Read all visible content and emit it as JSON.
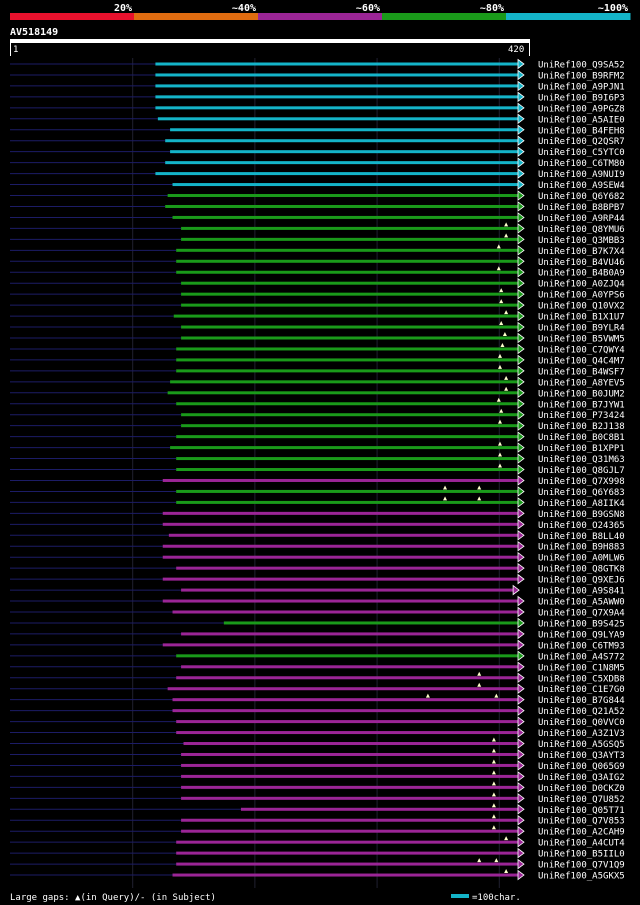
{
  "chart_data": {
    "type": "alignment-overview",
    "query_id": "AV518149",
    "query_start_label": "1",
    "query_end_label": "420",
    "query_length": 420,
    "identity_legend": [
      {
        "label": "20%",
        "color": "#e8112d"
      },
      {
        "label": "~40%",
        "color": "#e06c10"
      },
      {
        "label": "~60%",
        "color": "#9b2596"
      },
      {
        "label": "~80%",
        "color": "#1a9a1a"
      },
      {
        "label": "~100%",
        "color": "#14b4c8"
      }
    ],
    "footer_legend": "Large gaps: ▲(in Query)/- (in Subject)",
    "scale_legend": "=100char.",
    "hits": [
      {
        "name": "UniRef100_Q9SA52",
        "start": 120,
        "end": 420,
        "cls": 4,
        "gaps": []
      },
      {
        "name": "UniRef100_B9RFM2",
        "start": 120,
        "end": 420,
        "cls": 4,
        "gaps": []
      },
      {
        "name": "UniRef100_A9PJN1",
        "start": 120,
        "end": 420,
        "cls": 4,
        "gaps": []
      },
      {
        "name": "UniRef100_B9I6P3",
        "start": 120,
        "end": 420,
        "cls": 4,
        "gaps": []
      },
      {
        "name": "UniRef100_A9PGZ8",
        "start": 120,
        "end": 420,
        "cls": 4,
        "gaps": []
      },
      {
        "name": "UniRef100_A5AIE0",
        "start": 122,
        "end": 420,
        "cls": 4,
        "gaps": []
      },
      {
        "name": "UniRef100_B4FEH8",
        "start": 132,
        "end": 420,
        "cls": 4,
        "gaps": []
      },
      {
        "name": "UniRef100_Q2QSR7",
        "start": 128,
        "end": 420,
        "cls": 4,
        "gaps": []
      },
      {
        "name": "UniRef100_C5YTC0",
        "start": 132,
        "end": 420,
        "cls": 4,
        "gaps": []
      },
      {
        "name": "UniRef100_C6TM80",
        "start": 128,
        "end": 420,
        "cls": 4,
        "gaps": []
      },
      {
        "name": "UniRef100_A9NUI9",
        "start": 120,
        "end": 420,
        "cls": 4,
        "gaps": []
      },
      {
        "name": "UniRef100_A9SEW4",
        "start": 134,
        "end": 420,
        "cls": 4,
        "gaps": []
      },
      {
        "name": "UniRef100_Q6Y682",
        "start": 130,
        "end": 420,
        "cls": 3,
        "gaps": []
      },
      {
        "name": "UniRef100_B8BPB7",
        "start": 128,
        "end": 420,
        "cls": 3,
        "gaps": []
      },
      {
        "name": "UniRef100_A9RP44",
        "start": 134,
        "end": 420,
        "cls": 3,
        "gaps": []
      },
      {
        "name": "UniRef100_Q8YMU6",
        "start": 141,
        "end": 420,
        "cls": 3,
        "gaps": [
          407
        ]
      },
      {
        "name": "UniRef100_Q3MBB3",
        "start": 141,
        "end": 420,
        "cls": 3,
        "gaps": [
          407
        ]
      },
      {
        "name": "UniRef100_B7K7X4",
        "start": 137,
        "end": 420,
        "cls": 3,
        "gaps": [
          401
        ]
      },
      {
        "name": "UniRef100_B4VU46",
        "start": 137,
        "end": 420,
        "cls": 3,
        "gaps": []
      },
      {
        "name": "UniRef100_B4B0A9",
        "start": 137,
        "end": 420,
        "cls": 3,
        "gaps": [
          401
        ]
      },
      {
        "name": "UniRef100_A0ZJQ4",
        "start": 141,
        "end": 420,
        "cls": 3,
        "gaps": []
      },
      {
        "name": "UniRef100_A0YPS6",
        "start": 141,
        "end": 420,
        "cls": 3,
        "gaps": [
          403
        ]
      },
      {
        "name": "UniRef100_Q10VX2",
        "start": 141,
        "end": 420,
        "cls": 3,
        "gaps": [
          403
        ]
      },
      {
        "name": "UniRef100_B1X1U7",
        "start": 135,
        "end": 420,
        "cls": 3,
        "gaps": [
          407
        ]
      },
      {
        "name": "UniRef100_B9YLR4",
        "start": 141,
        "end": 420,
        "cls": 3,
        "gaps": [
          403
        ]
      },
      {
        "name": "UniRef100_B5VWM5",
        "start": 141,
        "end": 420,
        "cls": 3,
        "gaps": [
          406
        ]
      },
      {
        "name": "UniRef100_C7QWY4",
        "start": 137,
        "end": 420,
        "cls": 3,
        "gaps": [
          404
        ]
      },
      {
        "name": "UniRef100_Q4C4M7",
        "start": 137,
        "end": 420,
        "cls": 3,
        "gaps": [
          402
        ]
      },
      {
        "name": "UniRef100_B4WSF7",
        "start": 137,
        "end": 420,
        "cls": 3,
        "gaps": [
          402
        ]
      },
      {
        "name": "UniRef100_A8YEV5",
        "start": 132,
        "end": 420,
        "cls": 3,
        "gaps": [
          407
        ]
      },
      {
        "name": "UniRef100_B0JUM2",
        "start": 130,
        "end": 420,
        "cls": 3,
        "gaps": [
          407
        ]
      },
      {
        "name": "UniRef100_B7JYW1",
        "start": 137,
        "end": 420,
        "cls": 3,
        "gaps": [
          401
        ]
      },
      {
        "name": "UniRef100_P73424",
        "start": 141,
        "end": 420,
        "cls": 3,
        "gaps": [
          403
        ]
      },
      {
        "name": "UniRef100_B2J138",
        "start": 141,
        "end": 420,
        "cls": 3,
        "gaps": [
          402
        ]
      },
      {
        "name": "UniRef100_B0C8B1",
        "start": 137,
        "end": 420,
        "cls": 3,
        "gaps": []
      },
      {
        "name": "UniRef100_B1XPP1",
        "start": 132,
        "end": 420,
        "cls": 3,
        "gaps": [
          402
        ]
      },
      {
        "name": "UniRef100_Q31M63",
        "start": 137,
        "end": 420,
        "cls": 3,
        "gaps": [
          402
        ]
      },
      {
        "name": "UniRef100_Q8GJL7",
        "start": 137,
        "end": 420,
        "cls": 3,
        "gaps": [
          402
        ]
      },
      {
        "name": "UniRef100_Q7X998",
        "start": 126,
        "end": 420,
        "cls": 2,
        "gaps": []
      },
      {
        "name": "UniRef100_Q6Y683",
        "start": 137,
        "end": 420,
        "cls": 3,
        "gaps": [
          357,
          385
        ]
      },
      {
        "name": "UniRef100_A8IIK4",
        "start": 137,
        "end": 420,
        "cls": 3,
        "gaps": [
          357,
          385
        ]
      },
      {
        "name": "UniRef100_B9GSN8",
        "start": 126,
        "end": 420,
        "cls": 2,
        "gaps": []
      },
      {
        "name": "UniRef100_O24365",
        "start": 126,
        "end": 420,
        "cls": 2,
        "gaps": []
      },
      {
        "name": "UniRef100_B8LL40",
        "start": 131,
        "end": 420,
        "cls": 2,
        "gaps": []
      },
      {
        "name": "UniRef100_B9H883",
        "start": 126,
        "end": 420,
        "cls": 2,
        "gaps": []
      },
      {
        "name": "UniRef100_A0MLW6",
        "start": 126,
        "end": 420,
        "cls": 2,
        "gaps": []
      },
      {
        "name": "UniRef100_Q8GTK8",
        "start": 137,
        "end": 420,
        "cls": 2,
        "gaps": []
      },
      {
        "name": "UniRef100_Q9XEJ6",
        "start": 126,
        "end": 420,
        "cls": 2,
        "gaps": []
      },
      {
        "name": "UniRef100_A9S841",
        "start": 141,
        "end": 416,
        "cls": 2,
        "gaps": []
      },
      {
        "name": "UniRef100_A5AWW0",
        "start": 126,
        "end": 420,
        "cls": 2,
        "gaps": []
      },
      {
        "name": "UniRef100_Q7X9A4",
        "start": 134,
        "end": 420,
        "cls": 2,
        "gaps": []
      },
      {
        "name": "UniRef100_B9S425",
        "start": 176,
        "end": 420,
        "cls": 3,
        "gaps": []
      },
      {
        "name": "UniRef100_Q9LYA9",
        "start": 141,
        "end": 420,
        "cls": 2,
        "gaps": []
      },
      {
        "name": "UniRef100_C6TM93",
        "start": 126,
        "end": 420,
        "cls": 2,
        "gaps": []
      },
      {
        "name": "UniRef100_A4S772",
        "start": 137,
        "end": 420,
        "cls": 3,
        "gaps": []
      },
      {
        "name": "UniRef100_C1N8M5",
        "start": 141,
        "end": 420,
        "cls": 2,
        "gaps": []
      },
      {
        "name": "UniRef100_C5XDB8",
        "start": 137,
        "end": 420,
        "cls": 2,
        "gaps": [
          385
        ]
      },
      {
        "name": "UniRef100_C1E7G0",
        "start": 130,
        "end": 420,
        "cls": 2,
        "gaps": [
          385
        ]
      },
      {
        "name": "UniRef100_B7G844",
        "start": 134,
        "end": 420,
        "cls": 2,
        "gaps": [
          343,
          399
        ]
      },
      {
        "name": "UniRef100_Q21A52",
        "start": 134,
        "end": 420,
        "cls": 2,
        "gaps": []
      },
      {
        "name": "UniRef100_Q0VVC0",
        "start": 137,
        "end": 420,
        "cls": 2,
        "gaps": []
      },
      {
        "name": "UniRef100_A3Z1V3",
        "start": 137,
        "end": 420,
        "cls": 2,
        "gaps": []
      },
      {
        "name": "UniRef100_A5GSQ5",
        "start": 143,
        "end": 420,
        "cls": 2,
        "gaps": [
          397
        ]
      },
      {
        "name": "UniRef100_Q3AYT3",
        "start": 141,
        "end": 420,
        "cls": 2,
        "gaps": [
          397
        ]
      },
      {
        "name": "UniRef100_Q065G9",
        "start": 141,
        "end": 420,
        "cls": 2,
        "gaps": [
          397
        ]
      },
      {
        "name": "UniRef100_Q3AIG2",
        "start": 141,
        "end": 420,
        "cls": 2,
        "gaps": [
          397
        ]
      },
      {
        "name": "UniRef100_D0CKZ0",
        "start": 141,
        "end": 420,
        "cls": 2,
        "gaps": [
          397
        ]
      },
      {
        "name": "UniRef100_Q7U852",
        "start": 141,
        "end": 420,
        "cls": 2,
        "gaps": [
          397
        ]
      },
      {
        "name": "UniRef100_Q05T71",
        "start": 190,
        "end": 420,
        "cls": 2,
        "gaps": [
          397
        ]
      },
      {
        "name": "UniRef100_Q7V853",
        "start": 141,
        "end": 420,
        "cls": 2,
        "gaps": [
          397
        ]
      },
      {
        "name": "UniRef100_A2CAH9",
        "start": 141,
        "end": 420,
        "cls": 2,
        "gaps": [
          397
        ]
      },
      {
        "name": "UniRef100_A4CUT4",
        "start": 137,
        "end": 420,
        "cls": 2,
        "gaps": [
          407
        ]
      },
      {
        "name": "UniRef100_B5IIL0",
        "start": 137,
        "end": 420,
        "cls": 2,
        "gaps": []
      },
      {
        "name": "UniRef100_Q7V1Q9",
        "start": 137,
        "end": 420,
        "cls": 2,
        "gaps": [
          385,
          399
        ]
      },
      {
        "name": "UniRef100_A5GKX5",
        "start": 134,
        "end": 420,
        "cls": 2,
        "gaps": [
          407
        ]
      }
    ]
  }
}
